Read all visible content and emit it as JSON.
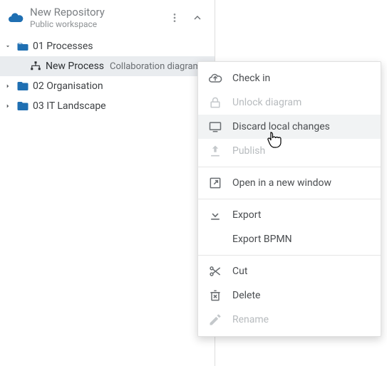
{
  "repo": {
    "title": "New Repository",
    "subtitle": "Public workspace"
  },
  "tree": {
    "items": [
      {
        "label": "01 Processes"
      },
      {
        "label": "New Process",
        "typeTag": "Collaboration diagram ."
      },
      {
        "label": "02 Organisation"
      },
      {
        "label": "03 IT Landscape"
      }
    ]
  },
  "menu": {
    "check_in": "Check in",
    "unlock_diagram": "Unlock diagram",
    "discard": "Discard local changes",
    "publish": "Publish",
    "open_new_window": "Open in a new window",
    "export": "Export",
    "export_bpmn": "Export BPMN",
    "cut": "Cut",
    "delete": "Delete",
    "rename": "Rename"
  },
  "colors": {
    "folder": "#1f6fb2",
    "muted": "#8d9194"
  }
}
